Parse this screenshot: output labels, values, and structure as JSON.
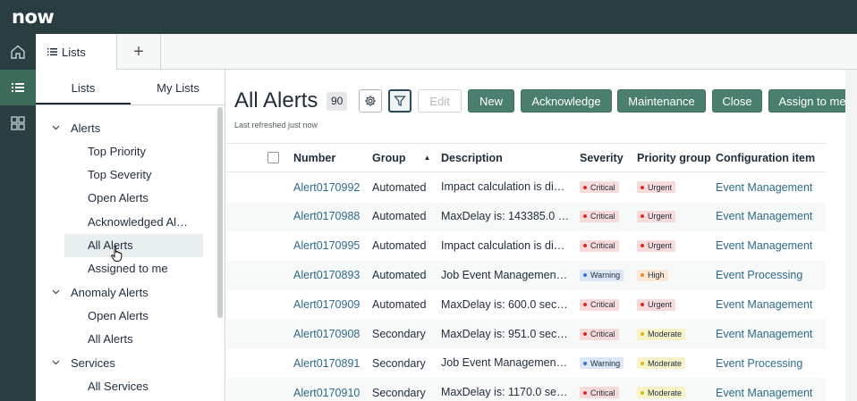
{
  "app": {
    "logo": "now"
  },
  "tabs": {
    "lists_label": "Lists",
    "add_label": "+"
  },
  "sidebar": {
    "tab_lists": "Lists",
    "tab_my_lists": "My Lists",
    "tree": [
      {
        "type": "group",
        "label": "Alerts"
      },
      {
        "type": "item",
        "label": "Top Priority"
      },
      {
        "type": "item",
        "label": "Top Severity"
      },
      {
        "type": "item",
        "label": "Open Alerts"
      },
      {
        "type": "item",
        "label": "Acknowledged Al…"
      },
      {
        "type": "item",
        "label": "All Alerts",
        "selected": true
      },
      {
        "type": "item",
        "label": "Assigned to me"
      },
      {
        "type": "group",
        "label": "Anomaly Alerts"
      },
      {
        "type": "item",
        "label": "Open Alerts"
      },
      {
        "type": "item",
        "label": "All Alerts"
      },
      {
        "type": "group",
        "label": "Services"
      },
      {
        "type": "item",
        "label": "All Services"
      }
    ]
  },
  "header": {
    "title": "All Alerts",
    "count": "90",
    "refreshed": "Last refreshed just now"
  },
  "toolbar": {
    "settings_icon": "gear-icon",
    "filter_icon": "filter-icon",
    "edit": "Edit",
    "new": "New",
    "acknowledge": "Acknowledge",
    "maintenance": "Maintenance",
    "close": "Close",
    "assign": "Assign to me"
  },
  "table": {
    "columns": [
      "Number",
      "Group",
      "Description",
      "Severity",
      "Priority group",
      "Configuration item"
    ],
    "sort_indicator": "▲",
    "rows": [
      {
        "number": "Alert0170992",
        "group": "Automated",
        "description": "Impact calculation is dis…",
        "severity": "Critical",
        "priority": "Urgent",
        "ci": "Event Management"
      },
      {
        "number": "Alert0170988",
        "group": "Automated",
        "description": "MaxDelay is: 143385.0 s…",
        "severity": "Critical",
        "priority": "Urgent",
        "ci": "Event Management"
      },
      {
        "number": "Alert0170995",
        "group": "Automated",
        "description": "Impact calculation is dis…",
        "severity": "Critical",
        "priority": "Urgent",
        "ci": "Event Management"
      },
      {
        "number": "Alert0170893",
        "group": "Automated",
        "description": "Job Event Management…",
        "severity": "Warning",
        "priority": "High",
        "ci": "Event Processing"
      },
      {
        "number": "Alert0170909",
        "group": "Automated",
        "description": "MaxDelay is: 600.0 seco…",
        "severity": "Critical",
        "priority": "Urgent",
        "ci": "Event Management"
      },
      {
        "number": "Alert0170908",
        "group": "Secondary",
        "description": "MaxDelay is: 951.0 seco…",
        "severity": "Critical",
        "priority": "Moderate",
        "ci": "Event Management"
      },
      {
        "number": "Alert0170891",
        "group": "Secondary",
        "description": "Job Event Management…",
        "severity": "Warning",
        "priority": "Moderate",
        "ci": "Event Processing"
      },
      {
        "number": "Alert0170910",
        "group": "Secondary",
        "description": "MaxDelay is: 1170.0 sec…",
        "severity": "Critical",
        "priority": "Moderate",
        "ci": "Event Management"
      }
    ]
  }
}
